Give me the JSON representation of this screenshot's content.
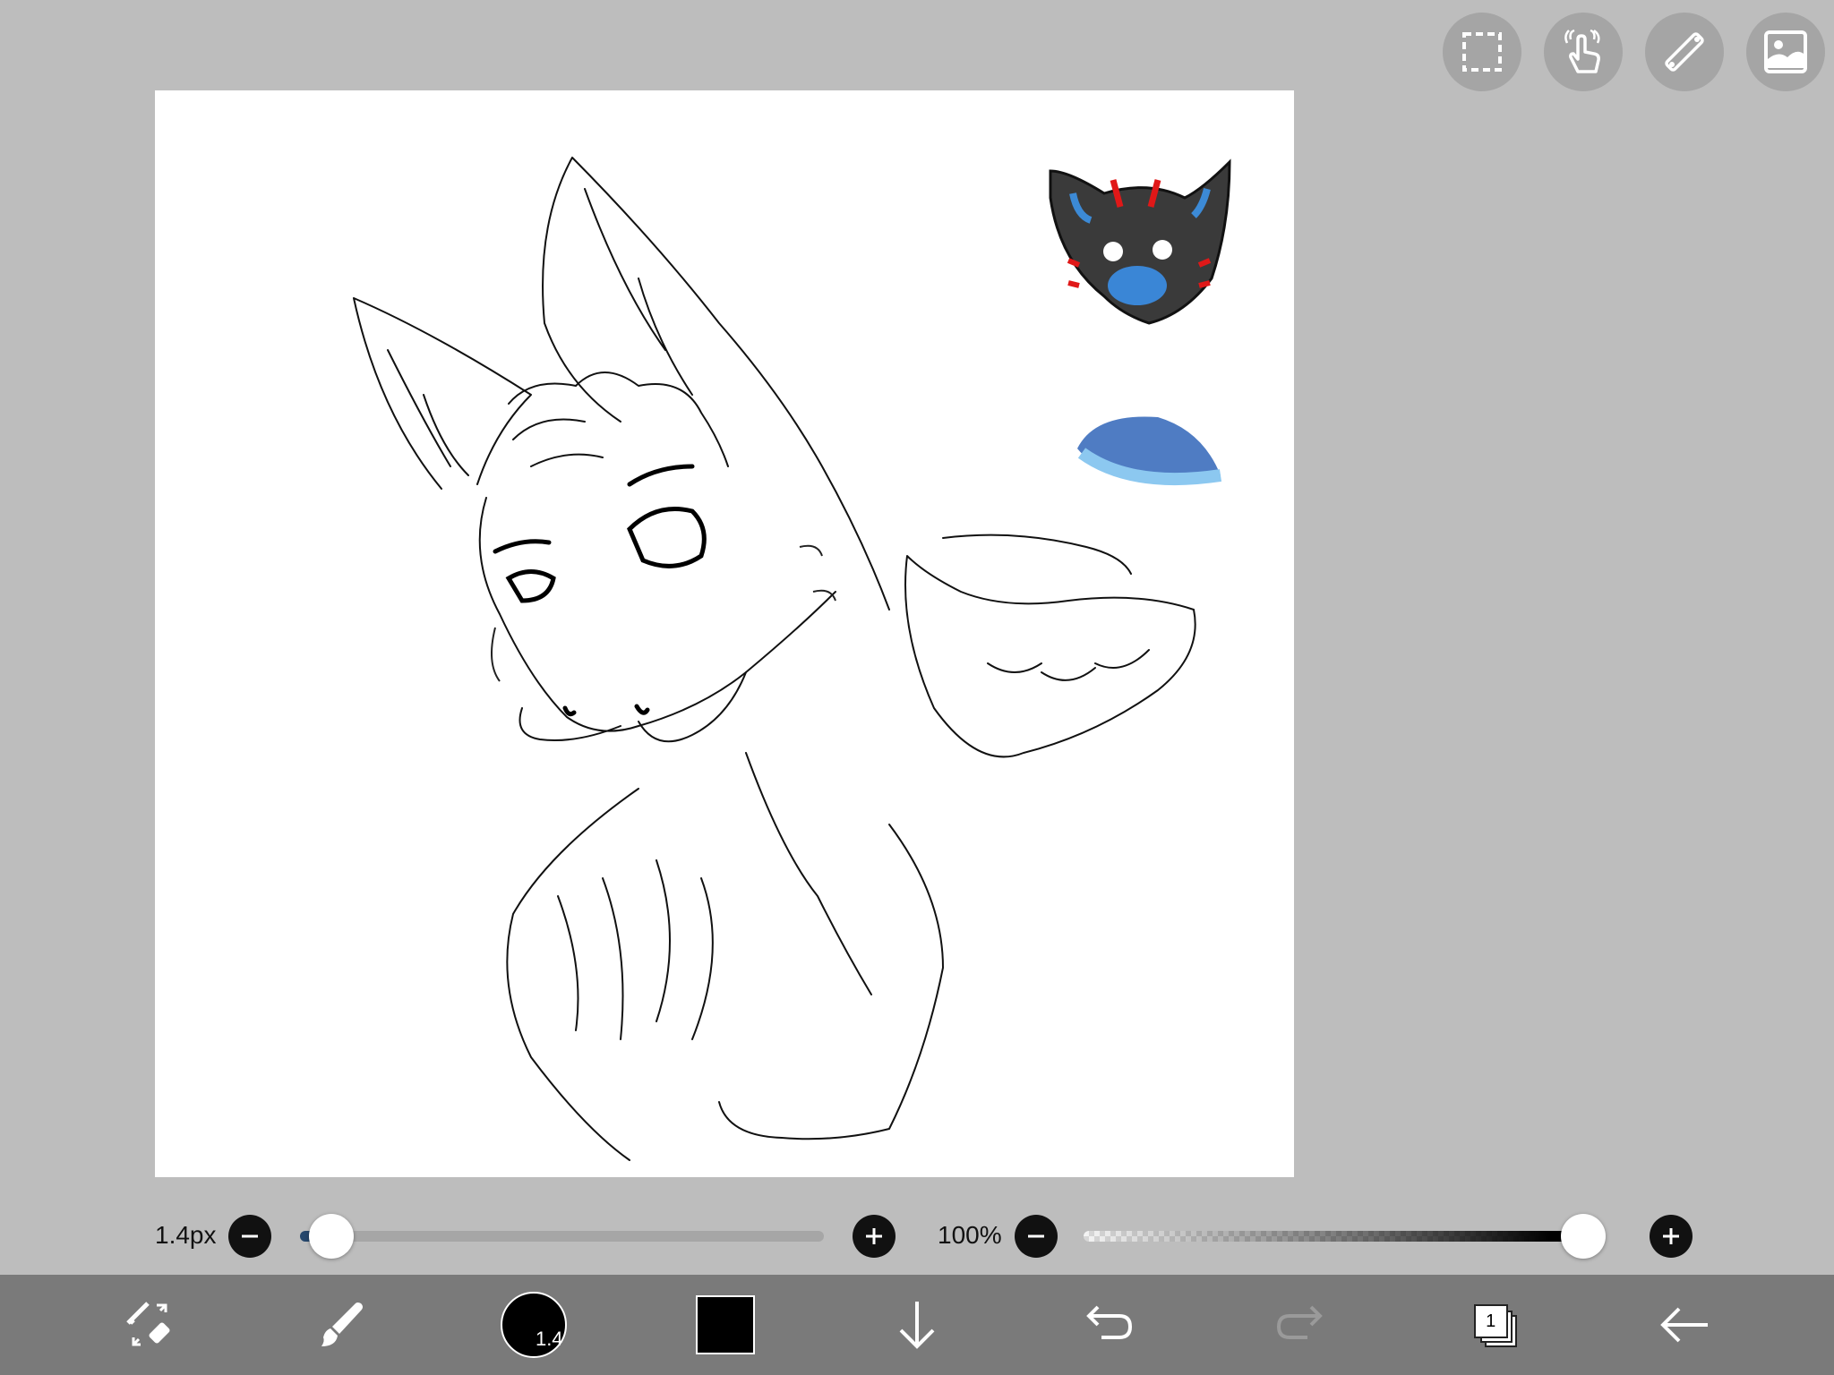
{
  "top_toolbar": {
    "icons": [
      "selection-icon",
      "touch-gesture-icon",
      "ruler-icon",
      "image-icon"
    ]
  },
  "brush_size": {
    "value_label": "1.4px",
    "level": 0.06
  },
  "opacity": {
    "value_label": "100%",
    "level": 1.0
  },
  "bottom_toolbar": {
    "brush_size_badge": "1.4",
    "current_color": "#000000",
    "layer_count": "1",
    "icons": [
      "tool-switch-icon",
      "brush-icon",
      "brush-preview",
      "color-swatch",
      "move-down-icon",
      "undo-icon",
      "redo-icon",
      "layers-icon",
      "back-arrow-icon"
    ]
  },
  "colors": {
    "background": "#bdbdbd",
    "canvas": "#ffffff",
    "toolbar": "#7a7a7a",
    "slider_fill": "#25466c",
    "redo_disabled": "#9a9a9a"
  }
}
